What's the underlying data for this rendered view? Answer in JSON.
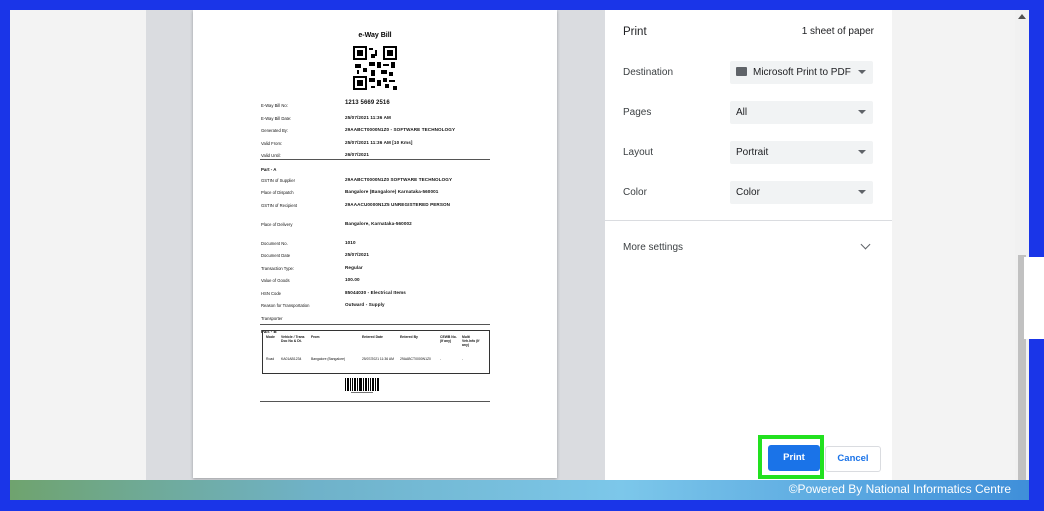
{
  "document": {
    "title": "e-Way Bill",
    "fields": [
      {
        "label": "E-Way Bill No:",
        "value": "1213 5669 2516",
        "big": true
      },
      {
        "label": "E-Way Bill Date:",
        "value": "25/07/2021 11:36 AM"
      },
      {
        "label": "Generated By:",
        "value": "29AABCT0000N1Z0 - SOFTWARE TECHNOLOGY"
      },
      {
        "label": "Valid From:",
        "value": "25/07/2021 11:36 AM [10 Kms]"
      },
      {
        "label": "Valid Until:",
        "value": "26/07/2021"
      }
    ],
    "part_a_title": "Part - A",
    "part_a": [
      {
        "label": "GSTIN of Supplier",
        "value": "29AABCT0000N1Z0 SOFTWARE TECHNOLOGY"
      },
      {
        "label": "Place of Dispatch",
        "value": "Bangalore (Bangalore) Karnataka-560001"
      },
      {
        "label": "GSTIN of Recipient",
        "value": "29AAACU0000N1Z5 UNREGISTERED PERSON"
      },
      {
        "label": "Place of Delivery",
        "value": "Bangalore, Karnataka-560002"
      },
      {
        "label": "Document No.",
        "value": "1010"
      },
      {
        "label": "Document Date",
        "value": "25/07/2021"
      },
      {
        "label": "Transaction Type:",
        "value": "Regular"
      },
      {
        "label": "Value of Goods",
        "value": "100.00"
      },
      {
        "label": "HSN Code",
        "value": "85044030 - Electrical Items"
      },
      {
        "label": "Reason for Transportation",
        "value": "Outward - Supply"
      },
      {
        "label": "Transporter",
        "value": ""
      }
    ],
    "part_b_title": "Part - B",
    "part_b_headers": [
      "Mode",
      "Vehicle / Trans Doc No & Dt.",
      "From",
      "Entered Date",
      "Entered By",
      "CEWB No. (If any)",
      "Multi Veh.Info (If any)"
    ],
    "part_b_row": [
      "Road",
      "KA01AB1234",
      "Bangalore (Bangalore)",
      "25/07/2021 11:36 AM",
      "29AABCT0000N1Z0",
      "-",
      "-"
    ]
  },
  "print_settings": {
    "title": "Print",
    "sheets": "1 sheet of paper",
    "destination_label": "Destination",
    "destination_value": "Microsoft Print to PDF",
    "destination_icon": "printer-icon",
    "pages_label": "Pages",
    "pages_value": "All",
    "layout_label": "Layout",
    "layout_value": "Portrait",
    "color_label": "Color",
    "color_value": "Color",
    "more_settings": "More settings",
    "print_button": "Print",
    "cancel_button": "Cancel"
  },
  "footer": {
    "text": "©Powered By National Informatics Centre"
  },
  "colors": {
    "frame": "#1a35e8",
    "primary": "#1a73e8",
    "highlight": "#22e11f"
  }
}
